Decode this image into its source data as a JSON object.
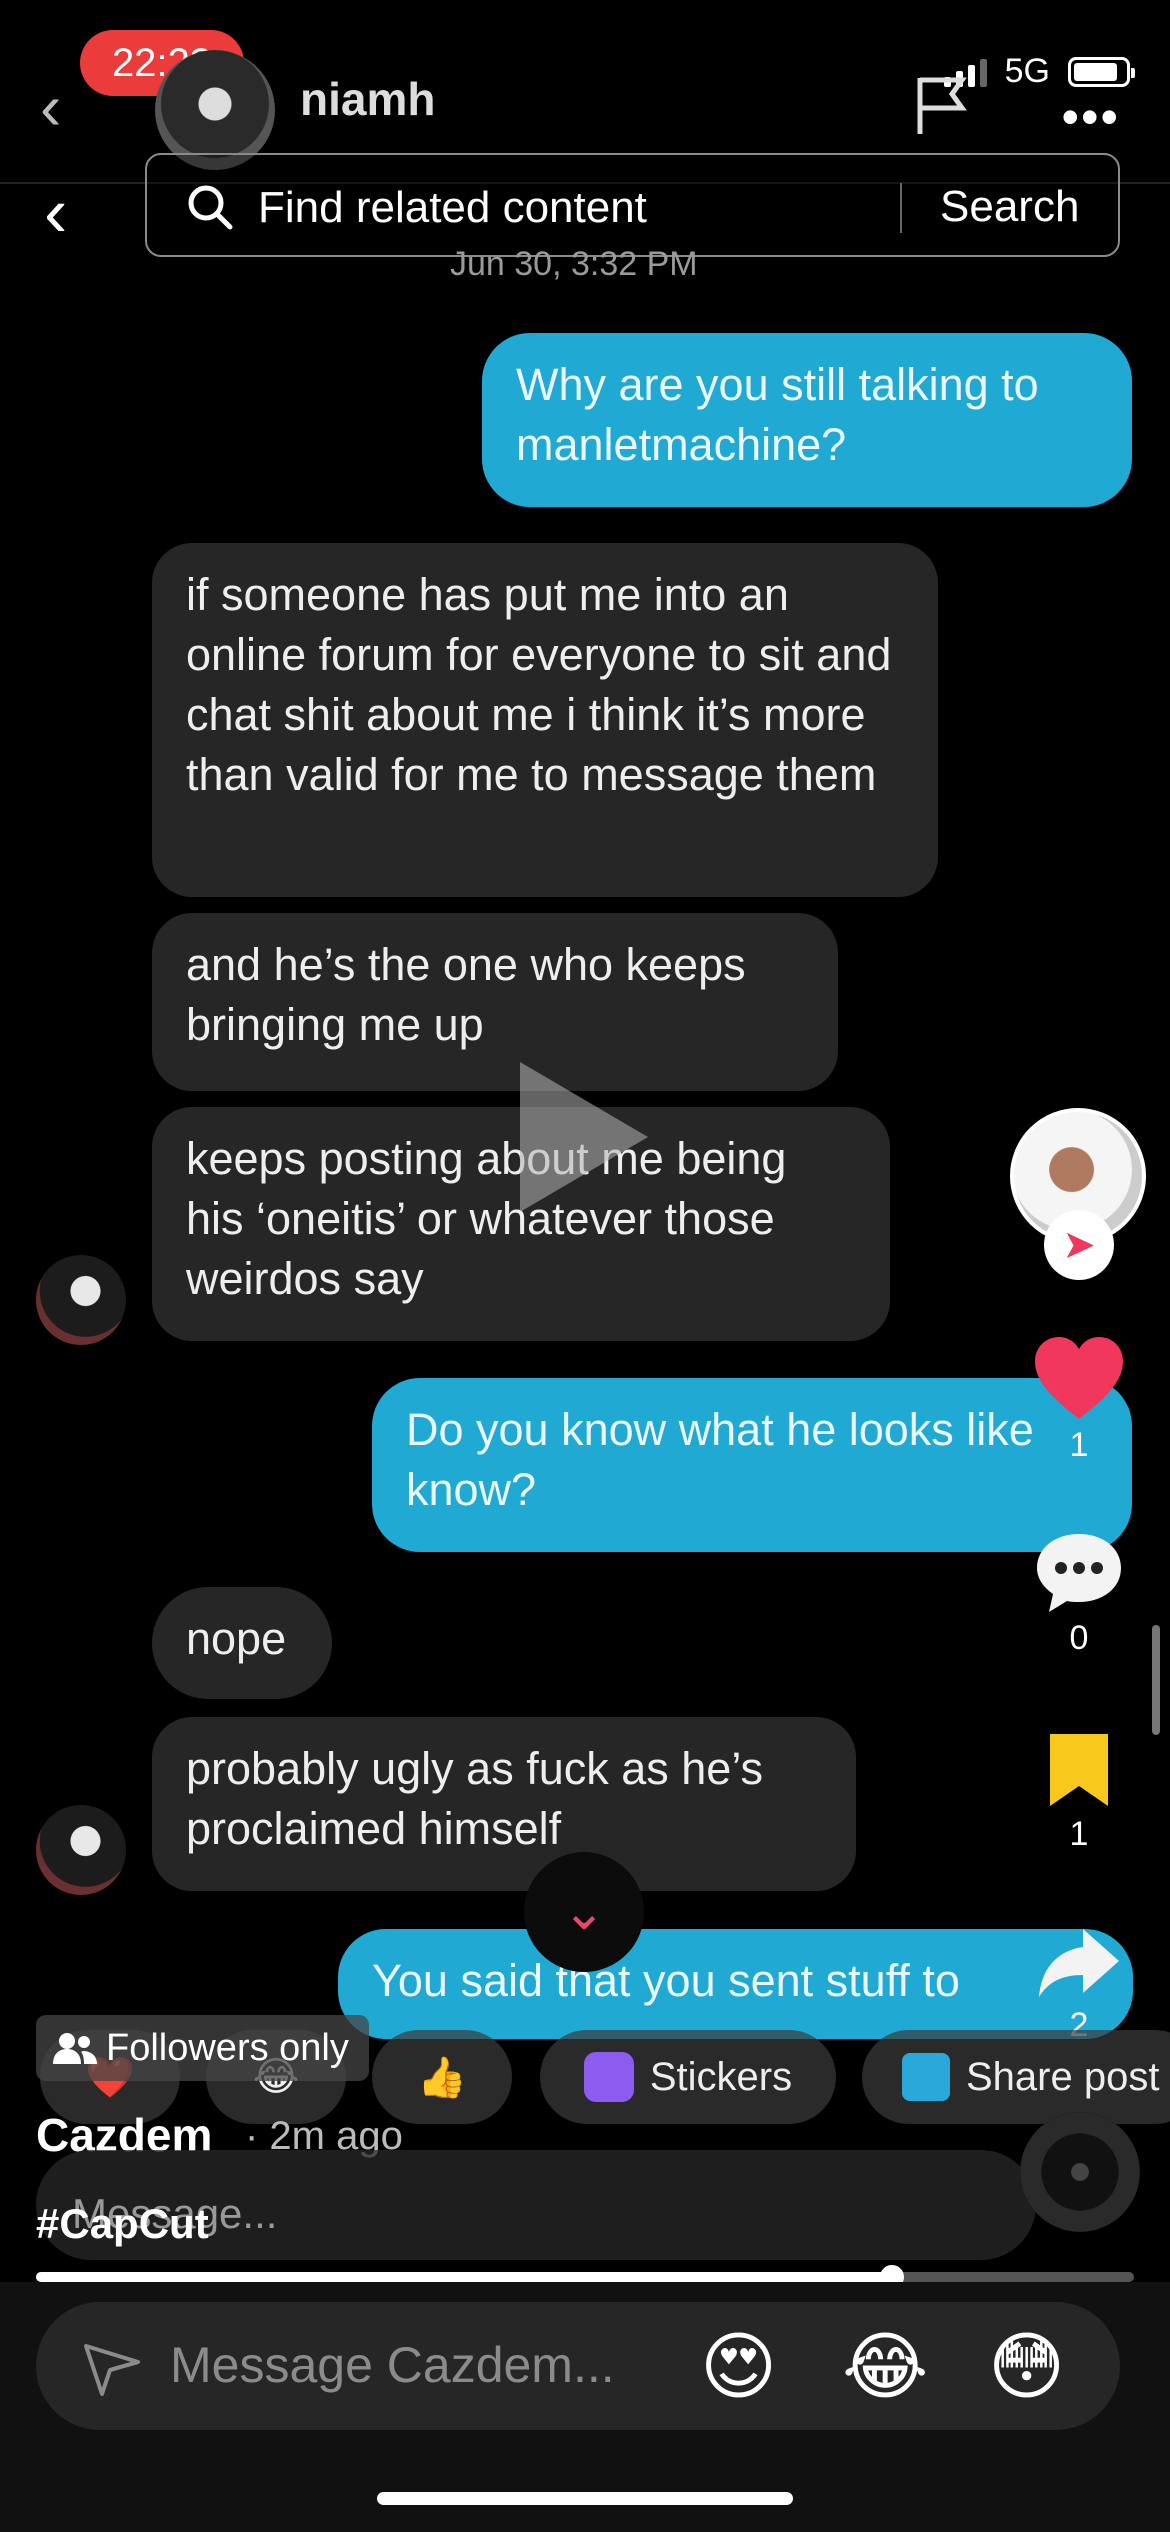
{
  "status_bar": {
    "time": "22:23",
    "network": "5G",
    "colors": {
      "time_pill": "#ec3b3b"
    }
  },
  "chat_header": {
    "contact_name": "niamh"
  },
  "search_bar": {
    "placeholder": "Find related content",
    "button": "Search"
  },
  "conversation": {
    "timestamp": "Jun 30, 3:32 PM",
    "messages": [
      {
        "side": "sent",
        "text": "Why are you still talking to manletmachine?"
      },
      {
        "side": "received",
        "text": "if someone has put me into an online forum for everyone to sit and chat shit about me i think it’s more than valid for me to message them"
      },
      {
        "side": "received",
        "text": "and he’s the one who keeps bringing me up"
      },
      {
        "side": "received",
        "text": "keeps posting about me being his ‘oneitis’ or whatever those weirdos say"
      },
      {
        "side": "sent",
        "text": "Do you know what he looks like know?"
      },
      {
        "side": "received",
        "text": "nope"
      },
      {
        "side": "received",
        "text": "probably ugly as fuck as he’s proclaimed himself"
      },
      {
        "side": "sent",
        "text": "You said that you sent stuff to"
      }
    ],
    "colors": {
      "sent_bubble": "#1fa9d3",
      "received_bubble": "#262626"
    }
  },
  "right_rail": {
    "like_count": "1",
    "comment_count": "0",
    "bookmark_count": "1",
    "share_count": "2",
    "colors": {
      "heart": "#f2375c",
      "bookmark": "#f8c91d"
    }
  },
  "reactions": {
    "items": [
      "heart-emoji",
      "laughing-emoji",
      "thumbs-up-emoji"
    ],
    "emoji_chars": [
      "❤️",
      "😂",
      "👍"
    ],
    "stickers_label": "Stickers",
    "share_post_label": "Share post"
  },
  "post": {
    "visibility": "Followers only",
    "creator": "Cazdem",
    "time_ago": "· 2m ago",
    "caption": "#CapCut",
    "chat_placeholder": "Message..."
  },
  "progress": {
    "fraction": 0.78
  },
  "bottom_bar": {
    "placeholder": "Message Cazdem...",
    "emojis": [
      "😍",
      "😂",
      "😳"
    ]
  }
}
